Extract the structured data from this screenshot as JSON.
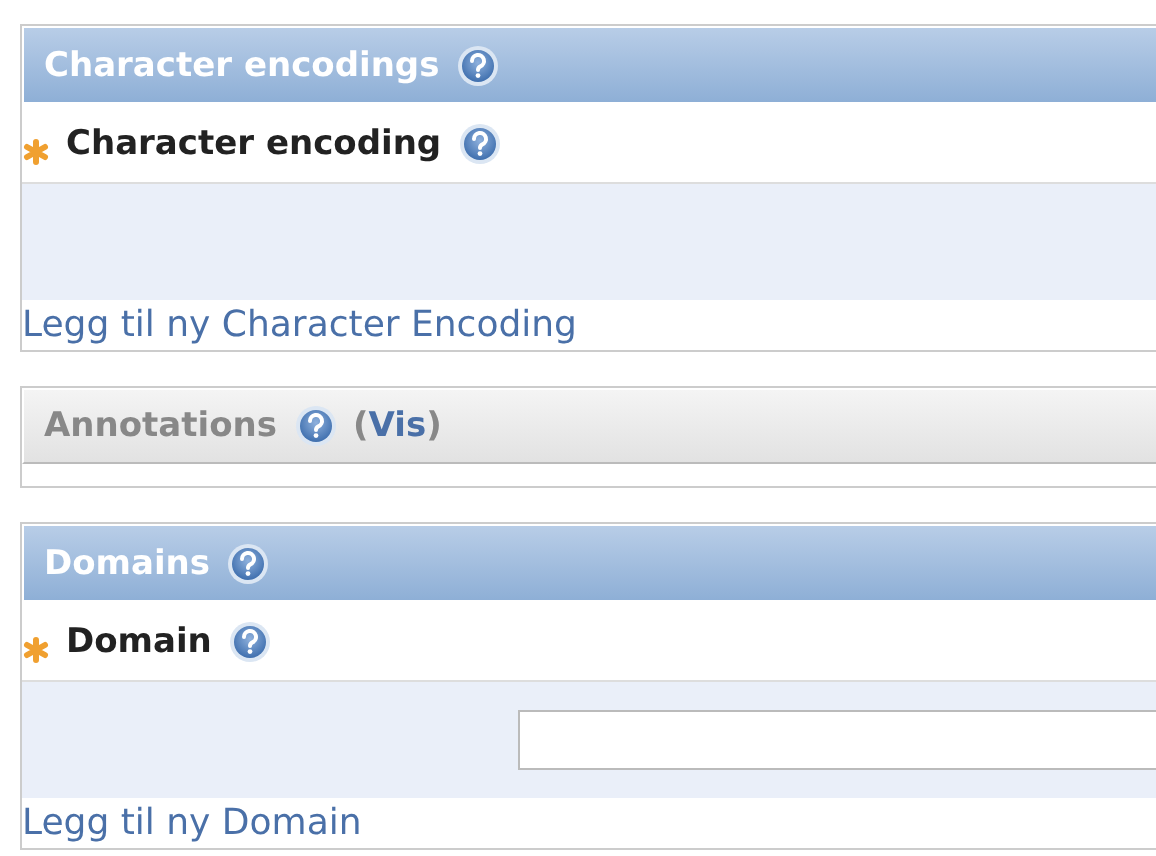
{
  "sections": [
    {
      "title": "Character encodings",
      "expanded": true,
      "field": {
        "label": "Character encoding",
        "required": true,
        "kind": "empty"
      },
      "add_link": "Legg til ny Character Encoding"
    },
    {
      "title": "Annotations",
      "expanded": false,
      "toggle_open": "(",
      "toggle": "Vis",
      "toggle_close": ")"
    },
    {
      "title": "Domains",
      "expanded": true,
      "field": {
        "label": "Domain",
        "required": true,
        "kind": "text-input"
      },
      "add_link": "Legg til ny Domain"
    }
  ]
}
